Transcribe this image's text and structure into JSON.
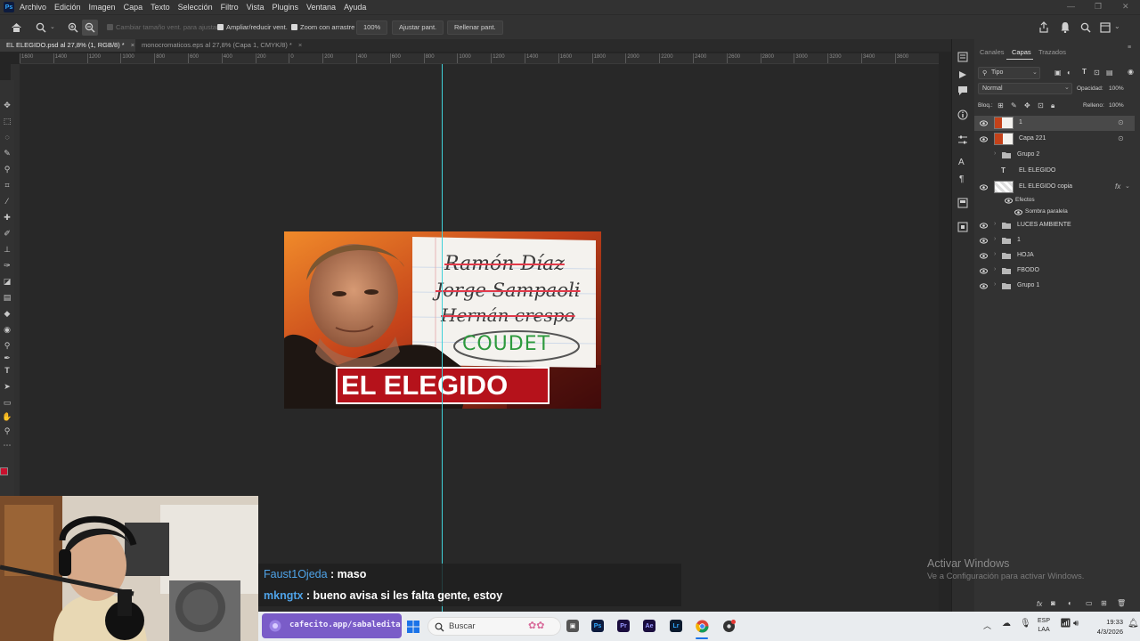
{
  "menubar": {
    "items": [
      "Archivo",
      "Edición",
      "Imagen",
      "Capa",
      "Texto",
      "Selección",
      "Filtro",
      "Vista",
      "Plugins",
      "Ventana",
      "Ayuda"
    ]
  },
  "options": {
    "resize_windows": "Cambiar tamaño vent. para ajustar",
    "zoom_all": "Ampliar/reducir vent.",
    "scrubby_zoom": "Zoom con arrastre",
    "zoom_level": "100%",
    "fit_screen": "Ajustar pant.",
    "fill_screen": "Rellenar pant."
  },
  "tabs": [
    {
      "label": "EL ELEGIDO.psd al 27,8% (1, RGB/8) *",
      "close": "×"
    },
    {
      "label": "monocromaticos.eps al 27,8% (Capa 1, CMYK/8) *",
      "close": "×"
    }
  ],
  "ruler": {
    "ticks": [
      "1600",
      "1400",
      "1200",
      "1000",
      "800",
      "600",
      "400",
      "200",
      "0",
      "200",
      "400",
      "600",
      "800",
      "1000",
      "1200",
      "1400",
      "1600",
      "1800",
      "2000",
      "2200",
      "2400",
      "2600",
      "2800",
      "3000",
      "3200",
      "3400",
      "3600"
    ]
  },
  "thumbnail": {
    "names": [
      "Ramón Díaz",
      "Jorge Sampaoli",
      "Hernán crespo"
    ],
    "choice": "COUDET",
    "title": "EL ELEGIDO"
  },
  "layers_panel": {
    "tabs": [
      "Canales",
      "Capas",
      "Trazados"
    ],
    "filter": "Tipo",
    "blend_mode": "Normal",
    "opacity_label": "Opacidad:",
    "opacity_value": "100%",
    "lock_label": "Bloq.:",
    "fill_label": "Relleno:",
    "fill_value": "100%",
    "effects_label": "Efectos",
    "drop_shadow": "Sombra paralela",
    "fx": "fx",
    "layers": [
      {
        "name": "1"
      },
      {
        "name": "Capa 221"
      },
      {
        "name": "Grupo 2"
      },
      {
        "name": "EL ELEGIDO"
      },
      {
        "name": "EL ELEGIDO copia"
      },
      {
        "name": "LUCES AMBIENTE"
      },
      {
        "name": "1"
      },
      {
        "name": "HOJA"
      },
      {
        "name": "FBODO"
      },
      {
        "name": "Grupo 1"
      }
    ]
  },
  "chat": {
    "messages": [
      {
        "user": "Faust1Ojeda",
        "text": " : maso"
      },
      {
        "user": "mkngtx",
        "text": " : bueno avisa si les falta gente, estoy"
      }
    ]
  },
  "watermark": {
    "title": "Activar Windows",
    "subtitle": "Ve a Configuración para activar Windows."
  },
  "taskbar": {
    "cafecito": "cafecito.app/sabaledita",
    "search": "Buscar",
    "lang_top": "ESP",
    "lang_bottom": "LAA",
    "time": "19:33",
    "date": "4/3/2026",
    "apps": [
      "Ps",
      "Pr",
      "Ae",
      "Lr"
    ]
  },
  "colors": {
    "accent_blue": "#31a8ff",
    "guide": "#3fd0d8",
    "title_red": "#b5121b",
    "cafecito_purple": "#7a5cc8",
    "foreground_swatch": "#c8102e"
  }
}
